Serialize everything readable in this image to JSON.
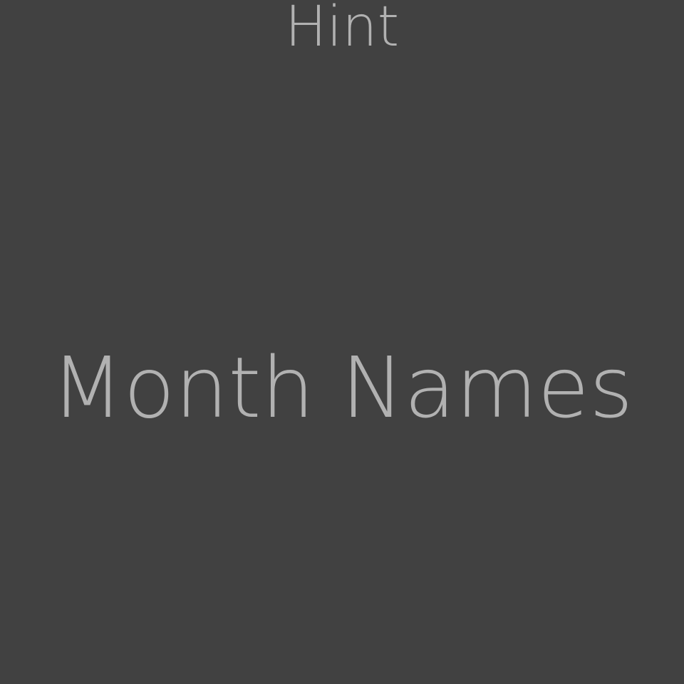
{
  "screen": {
    "title": "Hint",
    "hint_text": "Month Names"
  },
  "colors": {
    "background": "#414141",
    "text": "#b1b1b1"
  }
}
